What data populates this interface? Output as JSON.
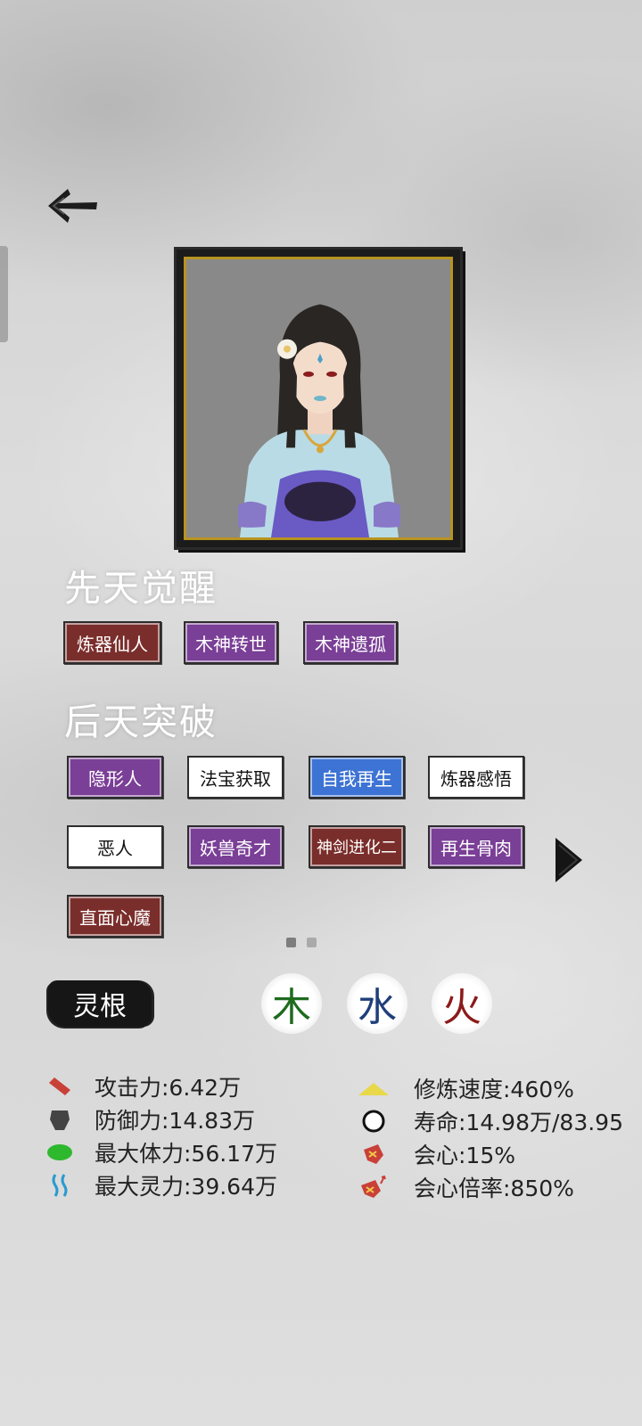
{
  "awaken": {
    "title": "先天觉醒",
    "traits": [
      {
        "label": "炼器仙人",
        "color": "red"
      },
      {
        "label": "木神转世",
        "color": "purple"
      },
      {
        "label": "木神遗孤",
        "color": "purple"
      }
    ]
  },
  "breakthrough": {
    "title": "后天突破",
    "traits": [
      {
        "label": "隐形人",
        "color": "purple"
      },
      {
        "label": "法宝获取",
        "color": "white"
      },
      {
        "label": "自我再生",
        "color": "blue"
      },
      {
        "label": "炼器感悟",
        "color": "white"
      },
      {
        "label": "恶人",
        "color": "white"
      },
      {
        "label": "妖兽奇才",
        "color": "purple"
      },
      {
        "label": "神剑进化二",
        "color": "red"
      },
      {
        "label": "再生骨肉",
        "color": "purple"
      },
      {
        "label": "直面心魔",
        "color": "red"
      }
    ]
  },
  "pager": {
    "total": 2,
    "active": 0
  },
  "spirit_root": {
    "label": "灵根",
    "elements": [
      {
        "char": "木",
        "color": "#1e6b1e"
      },
      {
        "char": "水",
        "color": "#1f3f7a"
      },
      {
        "char": "火",
        "color": "#8c1a1a"
      }
    ]
  },
  "stats": {
    "attack": {
      "text": "攻击力:6.42万",
      "icon": "blade-icon"
    },
    "defense": {
      "text": "防御力:14.83万",
      "icon": "shield-icon"
    },
    "max_hp": {
      "text": "最大体力:56.17万",
      "icon": "heart-icon"
    },
    "max_mp": {
      "text": "最大灵力:39.64万",
      "icon": "spirit-wave-icon"
    },
    "cultivation_speed": {
      "text": "修炼速度:460%",
      "icon": "triangle-icon"
    },
    "lifespan": {
      "text": "寿命:14.98万/83.95",
      "icon": "circle-icon"
    },
    "crit": {
      "text": "会心:15%",
      "icon": "crit-icon"
    },
    "crit_multiplier": {
      "text": "会心倍率:850%",
      "icon": "crit-multiplier-icon"
    }
  },
  "colors": {
    "red_chip": "#7a2e2b",
    "purple_chip": "#7a3f96",
    "blue_chip": "#3d73d4",
    "frame_gold": "#b8941f"
  }
}
